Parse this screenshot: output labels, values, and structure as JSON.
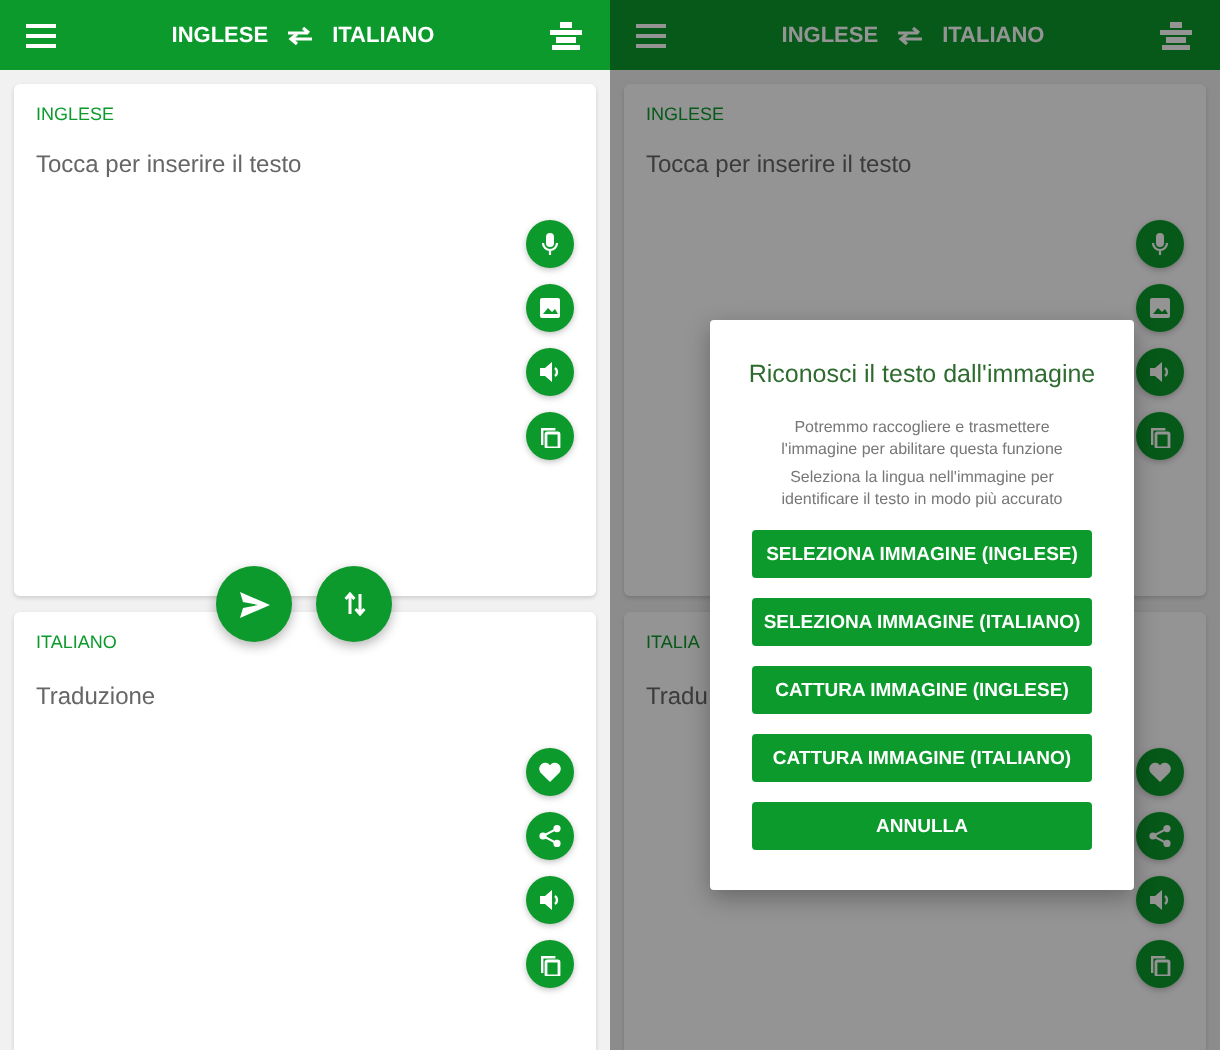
{
  "screens": [
    {
      "app_bar": {
        "source_language": "INGLESE",
        "target_language": "ITALIANO"
      },
      "cards": [
        {
          "kind": "source",
          "label": "INGLESE",
          "placeholder": "Tocca per inserire il testo"
        },
        {
          "kind": "target",
          "label": "ITALIANO",
          "placeholder": "Traduzione"
        }
      ]
    },
    {
      "app_bar": {
        "source_language": "INGLESE",
        "target_language": "ITALIANO"
      },
      "cards": [
        {
          "kind": "source",
          "label": "INGLESE",
          "placeholder": "Tocca per inserire il testo"
        },
        {
          "kind": "target",
          "label": "ITALIA",
          "placeholder": "Tradu"
        }
      ],
      "dialog": {
        "title": "Riconosci il testo dall'immagine",
        "paragraphs": [
          "Potremmo raccogliere e trasmettere l'immagine per abilitare questa funzione",
          "Seleziona la lingua nell'immagine per identificare il testo in modo più accurato"
        ],
        "buttons": [
          "SELEZIONA IMMAGINE (INGLESE)",
          "SELEZIONA IMMAGINE (ITALIANO)",
          "CATTURA IMMAGINE (INGLESE)",
          "CATTURA IMMAGINE (ITALIANO)",
          "ANNULLA"
        ]
      }
    }
  ]
}
